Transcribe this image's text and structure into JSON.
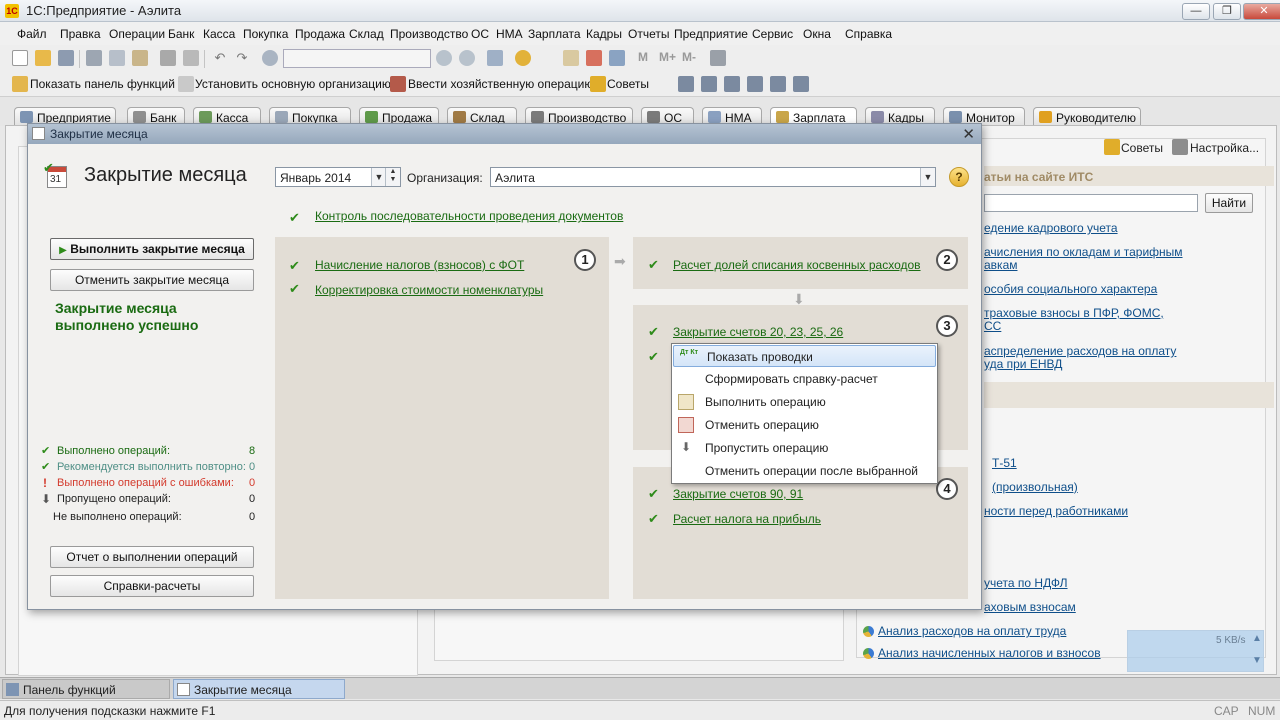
{
  "window": {
    "title": "1С:Предприятие - Аэлита"
  },
  "menu": [
    "Файл",
    "Правка",
    "Операции",
    "Банк",
    "Касса",
    "Покупка",
    "Продажа",
    "Склад",
    "Производство",
    "ОС",
    "НМА",
    "Зарплата",
    "Кадры",
    "Отчеты",
    "Предприятие",
    "Сервис",
    "Окна",
    "Справка"
  ],
  "toolbar2": {
    "show_panel": "Показать панель функций",
    "set_org": "Установить основную организацию",
    "enter_op": "Ввести хозяйственную операцию",
    "tips": "Советы"
  },
  "tabs": [
    "Предприятие",
    "Банк",
    "Касса",
    "Покупка",
    "Продажа",
    "Склад",
    "Производство",
    "ОС",
    "НМА",
    "Зарплата",
    "Кадры",
    "Монитор",
    "Руководителю"
  ],
  "background_right": {
    "tips": "Советы",
    "settings": "Настройка...",
    "its_title": "атьи на сайте ИТС",
    "find": "Найти",
    "links1": [
      "едение кадрового учета",
      "ачисления по окладам и тарифным",
      "авкам",
      "особия социального характера",
      "траховые взносы в ПФР, ФОМС,",
      "СС",
      "аспределение расходов на оплату",
      "уда при ЕНВД"
    ],
    "links2": [
      "Т-51",
      "(произвольная)",
      "ности перед работниками",
      "учета по НДФЛ",
      "аховым взносам"
    ],
    "analysis": [
      "Анализ расходов на оплату труда",
      "Анализ начисленных налогов и взносов"
    ],
    "net_speed": "5 KB/s"
  },
  "modal": {
    "title": "Закрытие месяца",
    "heading": "Закрытие месяца",
    "calendar_day": "31",
    "period": "Январь 2014",
    "org_label": "Организация:",
    "org_value": "Аэлита",
    "help": "?",
    "control_link": "Контроль последовательности проведения документов",
    "run_button": "Выполнить закрытие месяца",
    "cancel_button": "Отменить закрытие месяца",
    "result": "Закрытие месяца выполнено успешно",
    "stats": [
      {
        "label": "Выполнено операций:",
        "value": "8",
        "color": "#1a6b12"
      },
      {
        "label": "Рекомендуется выполнить повторно:",
        "value": "0",
        "color": "#4f8f86"
      },
      {
        "label": "Выполнено операций с ошибками:",
        "value": "0",
        "color": "#d33a2c"
      },
      {
        "label": "Пропущено операций:",
        "value": "0",
        "color": "#222222"
      },
      {
        "label": "Не выполнено операций:",
        "value": "0",
        "color": "#222222"
      }
    ],
    "report_button": "Отчет о выполнении операций",
    "refs_button": "Справки-расчеты",
    "steps": {
      "s1": {
        "num": "1",
        "ops": [
          "Начисление налогов (взносов) с ФОТ",
          "Корректировка стоимости номенклатуры"
        ]
      },
      "s2": {
        "num": "2",
        "ops": [
          "Расчет долей списания косвенных расходов"
        ]
      },
      "s3": {
        "num": "3",
        "ops": [
          "Закрытие счетов 20, 23, 25, 26"
        ]
      },
      "s4": {
        "num": "4",
        "ops": [
          "Закрытие счетов 90, 91",
          "Расчет налога на прибыль"
        ]
      }
    }
  },
  "context_menu": {
    "items": [
      "Показать проводки",
      "Сформировать справку-расчет",
      "Выполнить операцию",
      "Отменить операцию",
      "Пропустить операцию",
      "Отменить операции после выбранной"
    ],
    "dtkt_icon": "Дт Кт"
  },
  "taskbar": [
    "Панель функций",
    "Закрытие месяца"
  ],
  "statusbar": {
    "hint": "Для получения подсказки нажмите F1",
    "cap": "CAP",
    "num": "NUM"
  }
}
